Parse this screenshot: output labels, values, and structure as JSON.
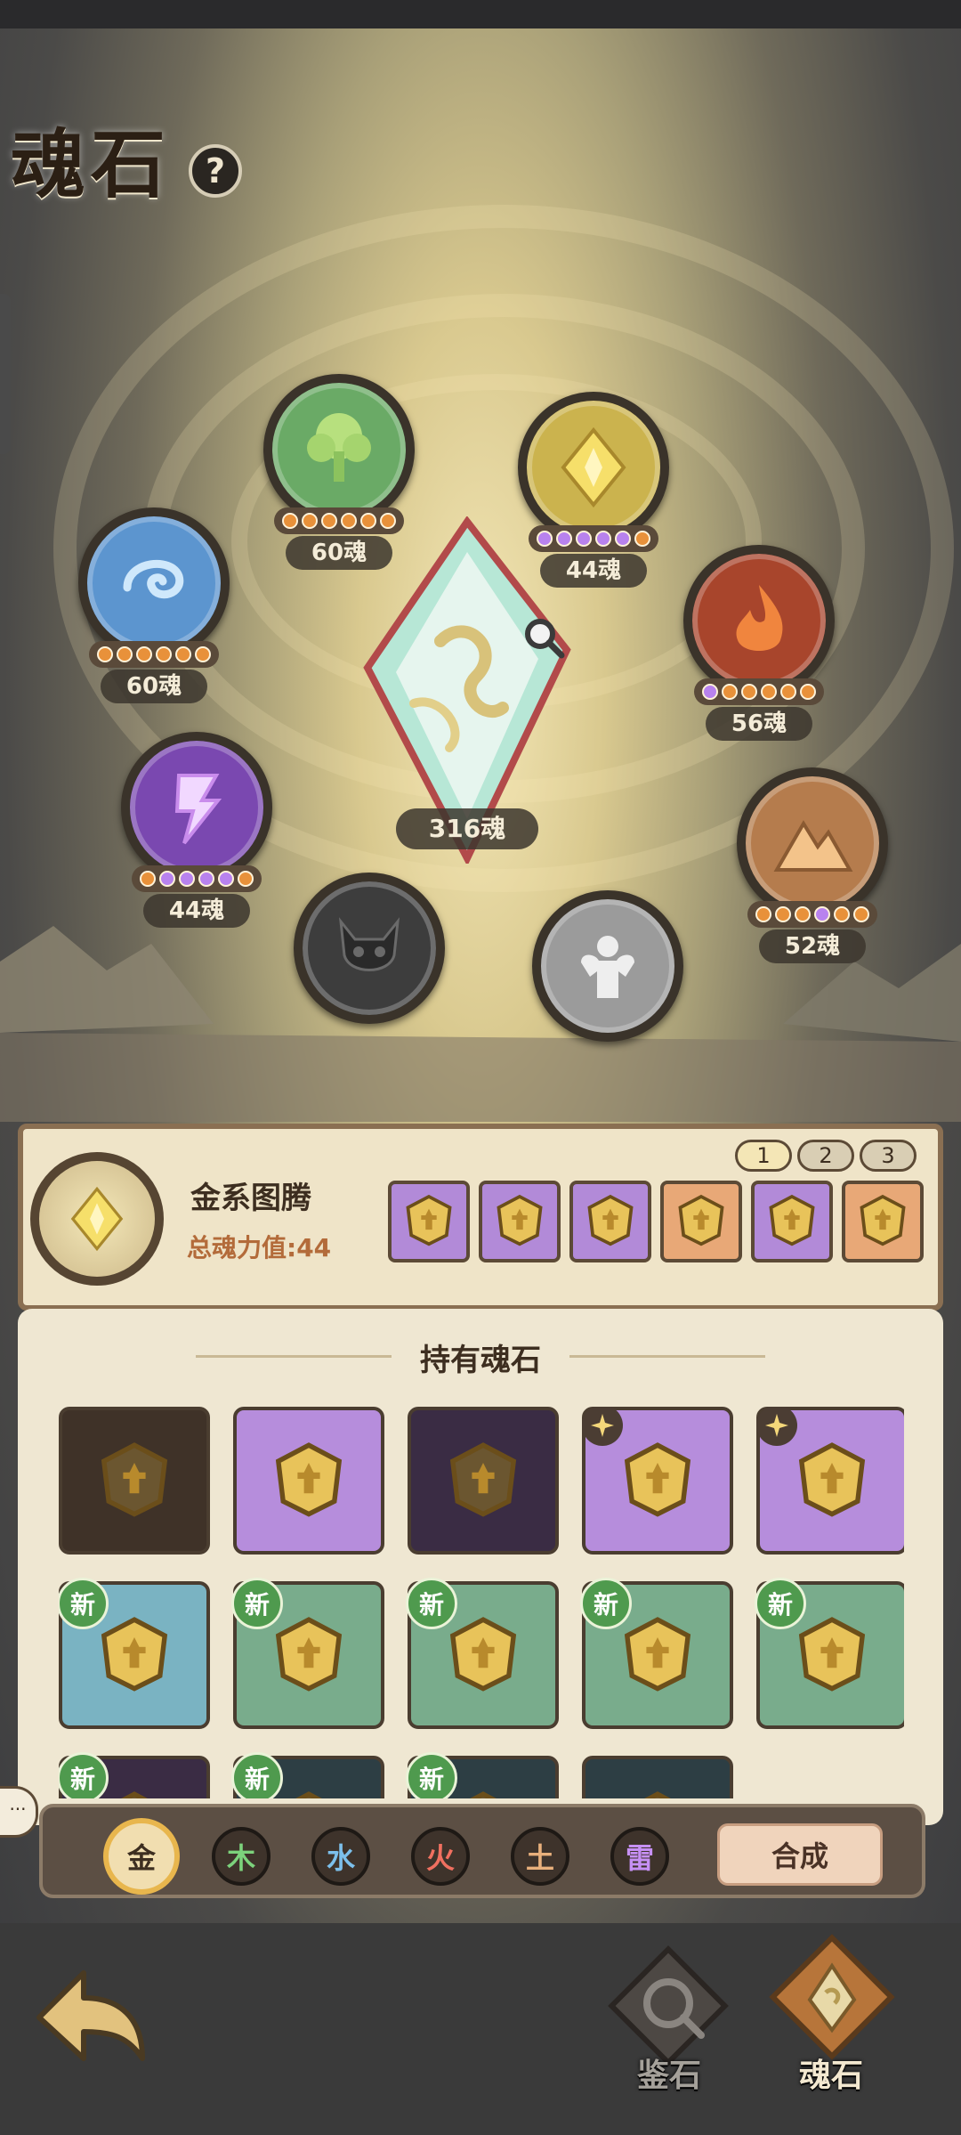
{
  "header": {
    "title": "魂石",
    "help_icon": "?"
  },
  "center_crystal": {
    "value": "316魂",
    "icon": "magnifier-icon"
  },
  "nodes": [
    {
      "key": "wood",
      "icon": "tree-icon",
      "value": "60魂",
      "color": "#7bbf6a",
      "dots": "oooooo"
    },
    {
      "key": "metal",
      "icon": "diamond-icon",
      "value": "44魂",
      "color": "#e8d06a",
      "dots": "pppppo"
    },
    {
      "key": "water",
      "icon": "swirl-icon",
      "value": "60魂",
      "color": "#6aa8de",
      "dots": "oooooo"
    },
    {
      "key": "fire",
      "icon": "flame-icon",
      "value": "56魂",
      "color": "#d8663e",
      "dots": "pooooo"
    },
    {
      "key": "thunder",
      "icon": "lightning-icon",
      "value": "44魂",
      "color": "#9b63d2",
      "dots": "oppppo"
    },
    {
      "key": "earth",
      "icon": "mountain-icon",
      "value": "52魂",
      "color": "#c58c5a",
      "dots": "ooopoo"
    },
    {
      "key": "demon",
      "icon": "demon-mask-icon",
      "value": "",
      "color": "#4b4b4b",
      "dots": ""
    },
    {
      "key": "strength",
      "icon": "muscle-icon",
      "value": "",
      "color": "#bfbfbf",
      "dots": ""
    }
  ],
  "totem_panel": {
    "title": "金系图腾",
    "subtitle": "总魂力值:44",
    "pages": [
      "1",
      "2",
      "3"
    ],
    "selected_page": "1",
    "slots": [
      "purple",
      "purple",
      "purple",
      "orange",
      "purple",
      "orange"
    ]
  },
  "inventory": {
    "title": "持有魂石",
    "items": [
      {
        "bg": "brown",
        "badge": ""
      },
      {
        "bg": "purple",
        "badge": ""
      },
      {
        "bg": "dark",
        "badge": ""
      },
      {
        "bg": "purple",
        "badge": "star"
      },
      {
        "bg": "purple",
        "badge": "star"
      },
      {
        "bg": "blue",
        "badge": "新"
      },
      {
        "bg": "green",
        "badge": "新"
      },
      {
        "bg": "green",
        "badge": "新"
      },
      {
        "bg": "green",
        "badge": "新"
      },
      {
        "bg": "green",
        "badge": "新"
      },
      {
        "bg": "dark",
        "badge": "新"
      },
      {
        "bg": "darkgreen",
        "badge": "新"
      },
      {
        "bg": "darkgreen",
        "badge": "新"
      },
      {
        "bg": "darkgreen",
        "badge": ""
      }
    ]
  },
  "filter_bar": {
    "elements": [
      {
        "label": "金",
        "color": "#3d2e20",
        "active": true
      },
      {
        "label": "木",
        "color": "#7cd27c",
        "active": false
      },
      {
        "label": "水",
        "color": "#7cc0ec",
        "active": false
      },
      {
        "label": "火",
        "color": "#f07060",
        "active": false
      },
      {
        "label": "土",
        "color": "#e8b07c",
        "active": false
      },
      {
        "label": "雷",
        "color": "#c690f4",
        "active": false
      }
    ],
    "compose_label": "合成"
  },
  "chat": {
    "label": "···"
  },
  "bottom_nav": {
    "back_icon": "back-arrow-icon",
    "tabs": [
      {
        "label": "鉴石",
        "icon": "appraise-icon",
        "active": false
      },
      {
        "label": "魂石",
        "icon": "soulstone-icon",
        "active": true
      }
    ]
  }
}
